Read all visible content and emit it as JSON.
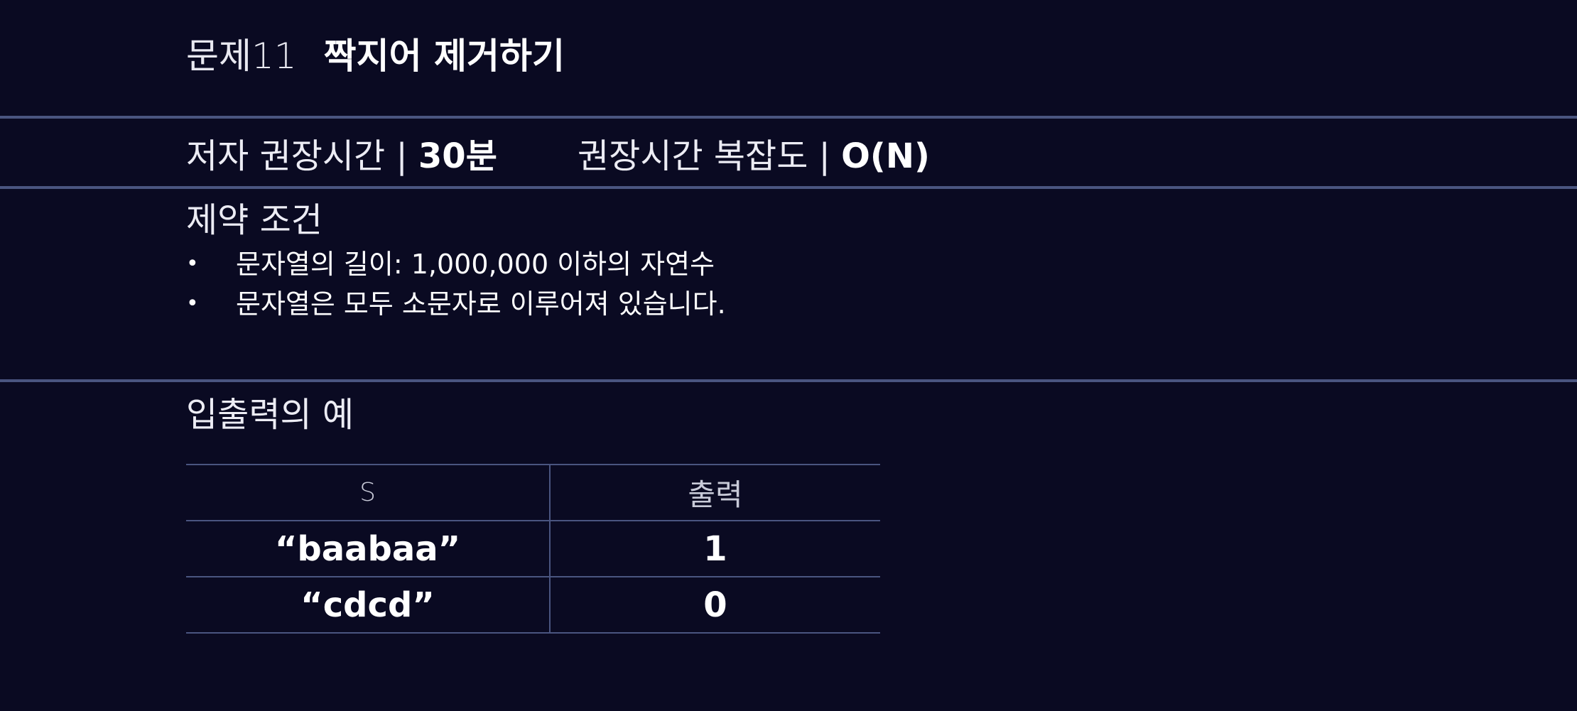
{
  "header": {
    "problem_number": "문제11",
    "problem_title": "짝지어 제거하기"
  },
  "meta": {
    "time_label": "저자 권장시간 | ",
    "time_value": "30분",
    "complexity_label": "권장시간 복잡도 | ",
    "complexity_value": "O(N)"
  },
  "constraints": {
    "heading": "제약 조건",
    "bullet": "•",
    "items": [
      "문자열의 길이: 1,000,000 이하의 자연수",
      "문자열은 모두 소문자로 이루어져 있습니다."
    ]
  },
  "examples": {
    "heading": "입출력의 예",
    "columns": [
      "S",
      "출력"
    ],
    "rows": [
      [
        "“baabaa”",
        "1"
      ],
      [
        "“cdcd”",
        "0"
      ]
    ]
  },
  "colors": {
    "background": "#0a0a22",
    "divider": "#4a5580",
    "text": "#ffffff"
  }
}
